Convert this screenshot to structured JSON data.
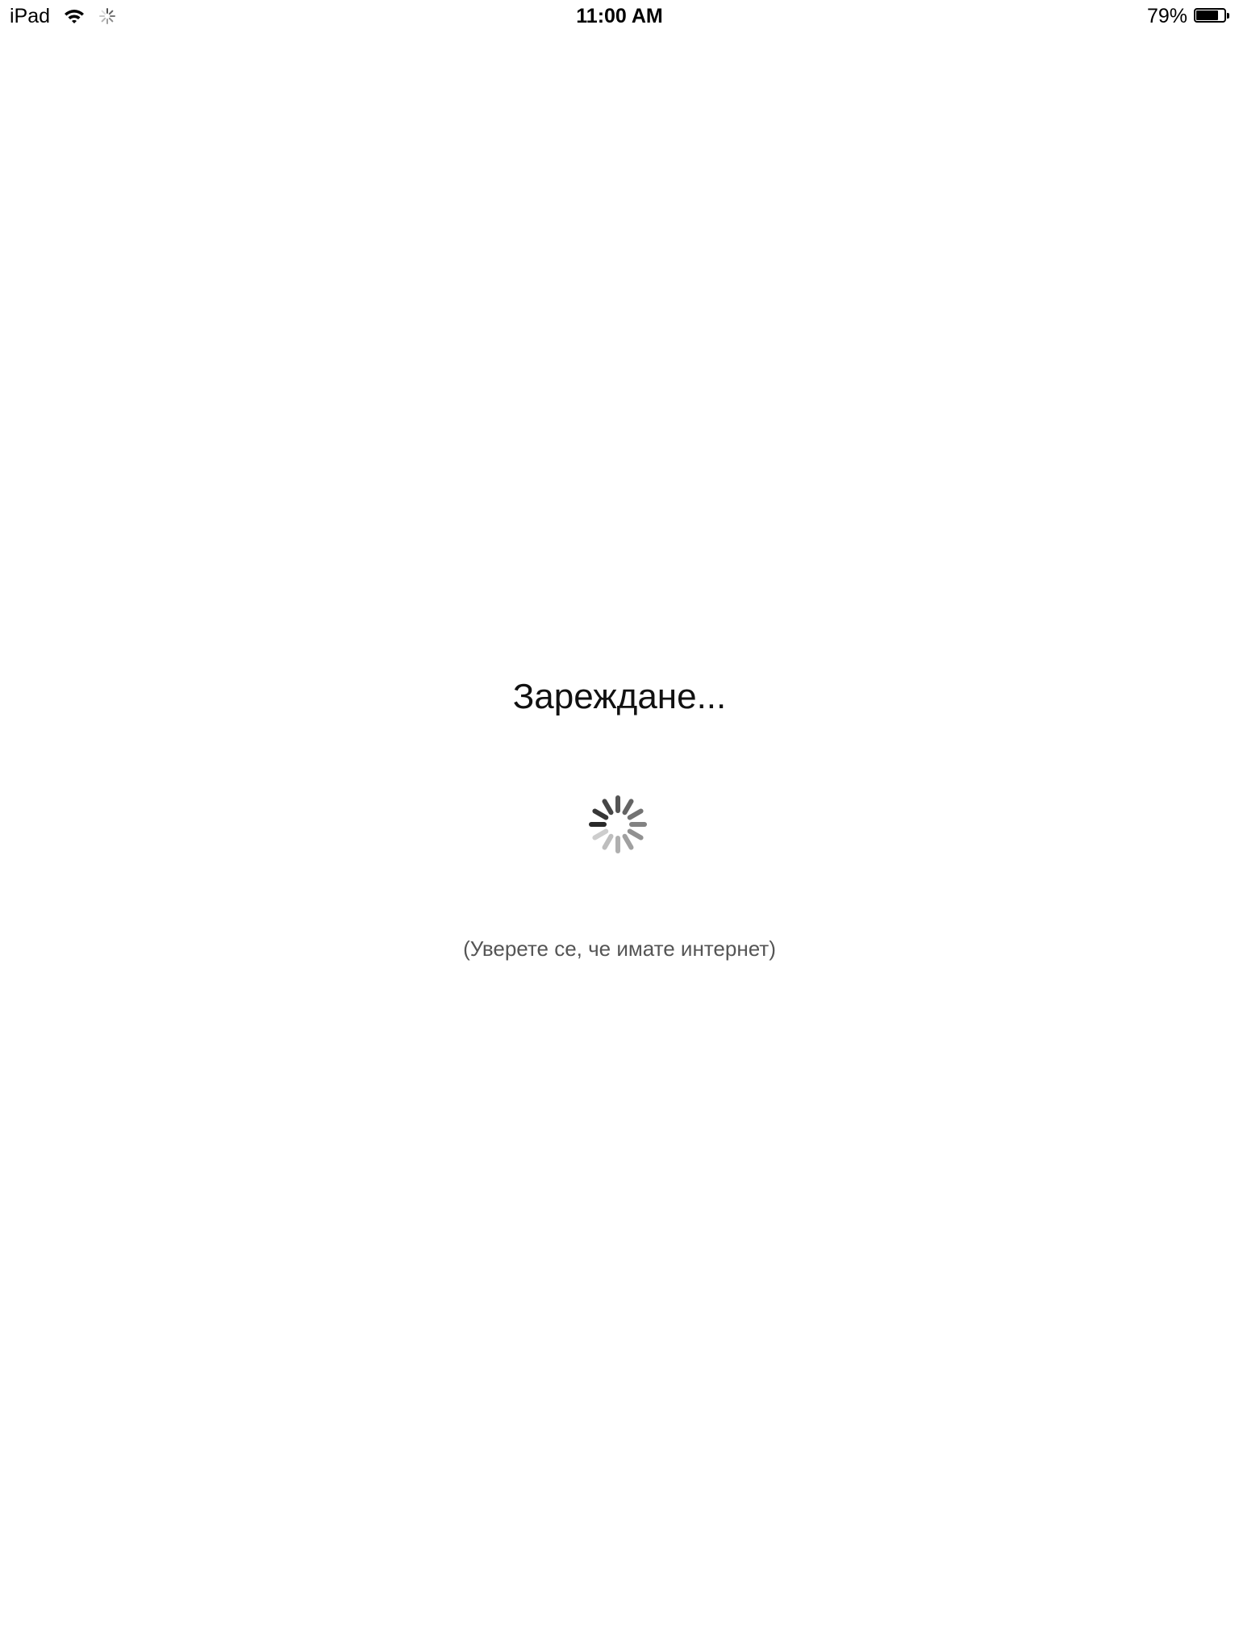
{
  "status_bar": {
    "device": "iPad",
    "time": "11:00 AM",
    "battery_percent": "79%",
    "battery_level": 0.79,
    "wifi_icon": "wifi-icon",
    "activity_icon": "network-activity-icon"
  },
  "main": {
    "title": "Зареждане...",
    "spinner_icon": "loading-spinner-icon",
    "hint": "(Уверете се, че имате интернет)"
  },
  "colors": {
    "background": "#ffffff",
    "text": "#111111",
    "hint_text": "#555555"
  }
}
